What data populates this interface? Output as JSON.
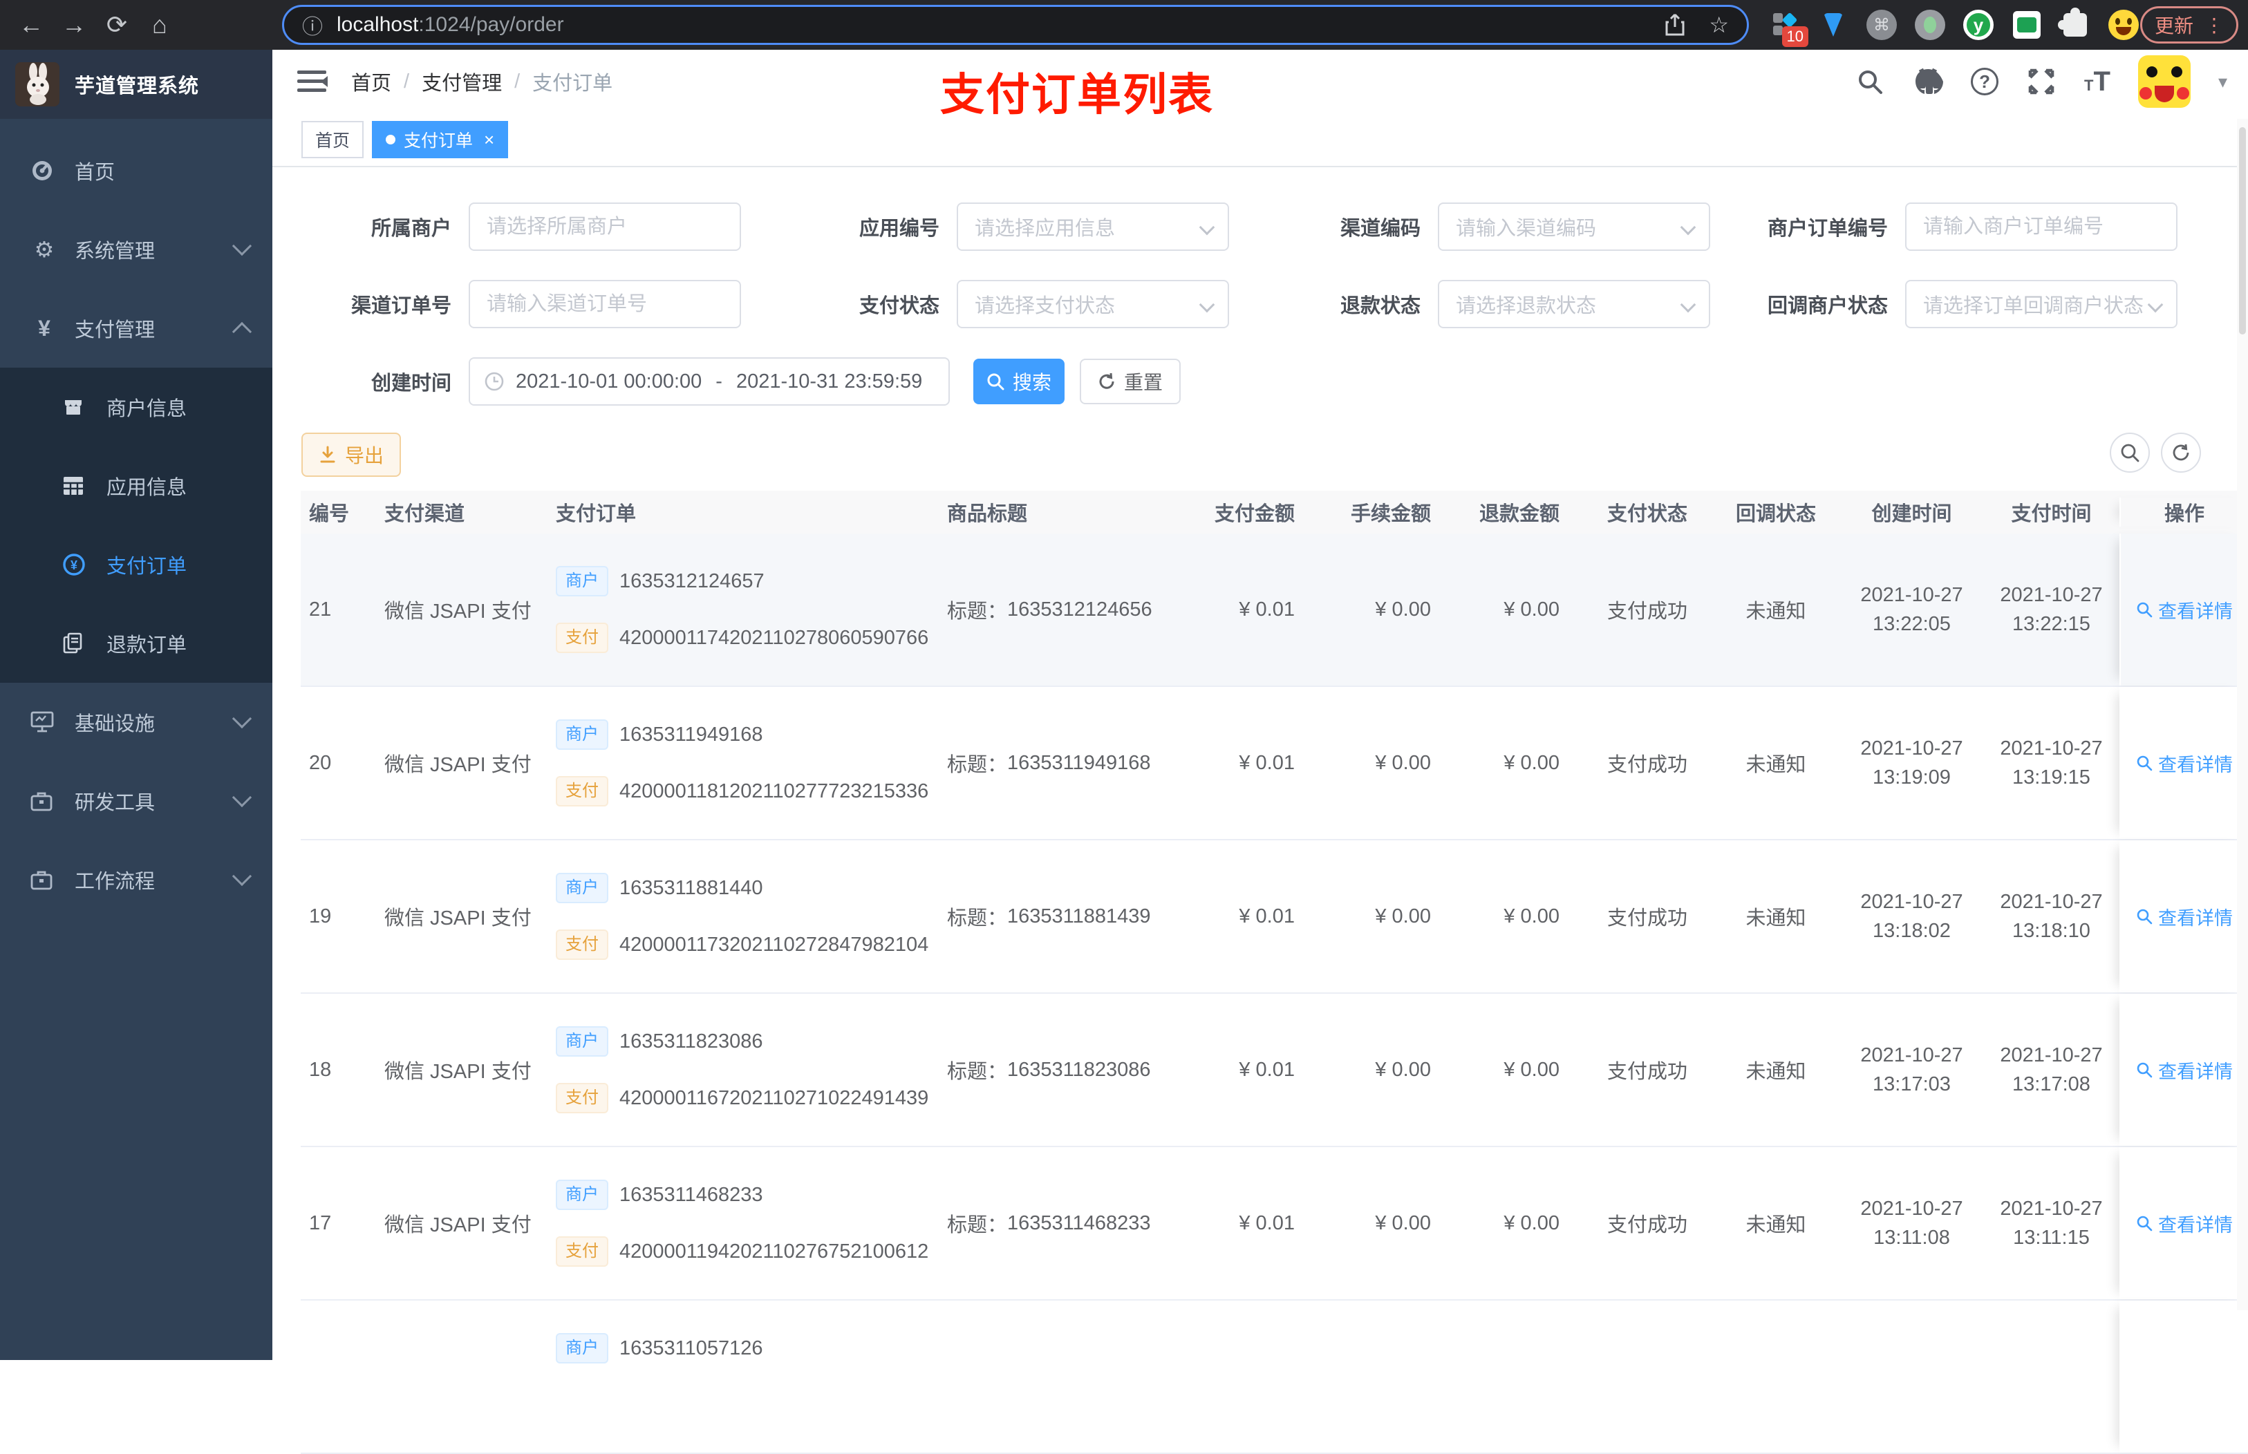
{
  "browser": {
    "url_host": "localhost",
    "url_rest": ":1024/pay/order",
    "update_label": "更新",
    "extension_badge": "10",
    "ext_y_glyph": "y"
  },
  "icons": {
    "back": "←",
    "forward": "→",
    "reload": "⟳",
    "home": "⌂",
    "info": "ⓘ",
    "star": "☆",
    "command": "⌘",
    "menu_dots": "⋮",
    "caret": "▾",
    "close": "×",
    "yen": "¥",
    "gear": "⚙",
    "question": "?",
    "slash": "/"
  },
  "sidebar": {
    "title": "芋道管理系统",
    "items": [
      {
        "label": "首页"
      },
      {
        "label": "系统管理"
      },
      {
        "label": "支付管理"
      }
    ],
    "submenu": [
      {
        "label": "商户信息"
      },
      {
        "label": "应用信息"
      },
      {
        "label": "支付订单"
      },
      {
        "label": "退款订单"
      }
    ],
    "items_bottom": [
      {
        "label": "基础设施"
      },
      {
        "label": "研发工具"
      },
      {
        "label": "工作流程"
      }
    ]
  },
  "header": {
    "breadcrumb1": "首页",
    "breadcrumb2": "支付管理",
    "breadcrumb3": "支付订单",
    "annotation": "支付订单列表"
  },
  "tabs": {
    "home": "首页",
    "current": "支付订单"
  },
  "filters": {
    "merchant": {
      "label": "所属商户",
      "placeholder": "请选择所属商户"
    },
    "app": {
      "label": "应用编号",
      "placeholder": "请选择应用信息"
    },
    "channel_code": {
      "label": "渠道编码",
      "placeholder": "请输入渠道编码"
    },
    "merchant_order_no": {
      "label": "商户订单编号",
      "placeholder": "请输入商户订单编号"
    },
    "channel_order_no": {
      "label": "渠道订单号",
      "placeholder": "请输入渠道订单号"
    },
    "pay_status": {
      "label": "支付状态",
      "placeholder": "请选择支付状态"
    },
    "refund_status": {
      "label": "退款状态",
      "placeholder": "请选择退款状态"
    },
    "callback_status": {
      "label": "回调商户状态",
      "placeholder": "请选择订单回调商户状态"
    },
    "create_time": {
      "label": "创建时间",
      "start": "2021-10-01 00:00:00",
      "end": "2021-10-31 23:59:59",
      "separator": "-"
    },
    "search_label": "搜索",
    "reset_label": "重置"
  },
  "toolbar": {
    "export_label": "导出"
  },
  "table": {
    "headers": [
      "编号",
      "支付渠道",
      "支付订单",
      "商品标题",
      "支付金额",
      "手续金额",
      "退款金额",
      "支付状态",
      "回调状态",
      "创建时间",
      "支付时间",
      "操作"
    ],
    "merchant_tag": "商户",
    "pay_tag": "支付",
    "title_prefix": "标题：",
    "action_label": "查看详情",
    "rows": [
      {
        "id": "21",
        "channel": "微信 JSAPI 支付",
        "merchant_no": "1635312124657",
        "pay_no": "4200001174202110278060590766",
        "title": "1635312124656",
        "amount": "¥ 0.01",
        "fee": "¥ 0.00",
        "refund": "¥ 0.00",
        "pay_status": "支付成功",
        "notify_status": "未通知",
        "create_date": "2021-10-27",
        "create_time": "13:22:05",
        "pay_date": "2021-10-27",
        "pay_time": "13:22:15",
        "action": true,
        "hover": true
      },
      {
        "id": "20",
        "channel": "微信 JSAPI 支付",
        "merchant_no": "1635311949168",
        "pay_no": "4200001181202110277723215336",
        "title": "1635311949168",
        "amount": "¥ 0.01",
        "fee": "¥ 0.00",
        "refund": "¥ 0.00",
        "pay_status": "支付成功",
        "notify_status": "未通知",
        "create_date": "2021-10-27",
        "create_time": "13:19:09",
        "pay_date": "2021-10-27",
        "pay_time": "13:19:15",
        "action": true
      },
      {
        "id": "19",
        "channel": "微信 JSAPI 支付",
        "merchant_no": "1635311881440",
        "pay_no": "4200001173202110272847982104",
        "title": "1635311881439",
        "amount": "¥ 0.01",
        "fee": "¥ 0.00",
        "refund": "¥ 0.00",
        "pay_status": "支付成功",
        "notify_status": "未通知",
        "create_date": "2021-10-27",
        "create_time": "13:18:02",
        "pay_date": "2021-10-27",
        "pay_time": "13:18:10",
        "action": true
      },
      {
        "id": "18",
        "channel": "微信 JSAPI 支付",
        "merchant_no": "1635311823086",
        "pay_no": "4200001167202110271022491439",
        "title": "1635311823086",
        "amount": "¥ 0.01",
        "fee": "¥ 0.00",
        "refund": "¥ 0.00",
        "pay_status": "支付成功",
        "notify_status": "未通知",
        "create_date": "2021-10-27",
        "create_time": "13:17:03",
        "pay_date": "2021-10-27",
        "pay_time": "13:17:08",
        "action": true
      },
      {
        "id": "17",
        "channel": "微信 JSAPI 支付",
        "merchant_no": "1635311468233",
        "pay_no": "4200001194202110276752100612",
        "title": "1635311468233",
        "amount": "¥ 0.01",
        "fee": "¥ 0.00",
        "refund": "¥ 0.00",
        "pay_status": "支付成功",
        "notify_status": "未通知",
        "create_date": "2021-10-27",
        "create_time": "13:11:08",
        "pay_date": "2021-10-27",
        "pay_time": "13:11:15",
        "action": true
      },
      {
        "id": "",
        "channel": "",
        "merchant_no": "1635311057126",
        "pay_no": "",
        "title": "",
        "amount": "",
        "fee": "",
        "refund": "",
        "pay_status": "",
        "notify_status": "",
        "create_date": "",
        "create_time": "",
        "pay_date": "",
        "pay_time": "",
        "action": false
      }
    ]
  },
  "colors": {
    "primary": "#409eff",
    "warning": "#e6a23c",
    "annotation_red": "#ff1b00",
    "sidebar_bg": "#304156",
    "submenu_bg": "#1f2d3d",
    "tag_blue_text": "#409eff",
    "tag_yellow_text": "#e6a23c"
  }
}
